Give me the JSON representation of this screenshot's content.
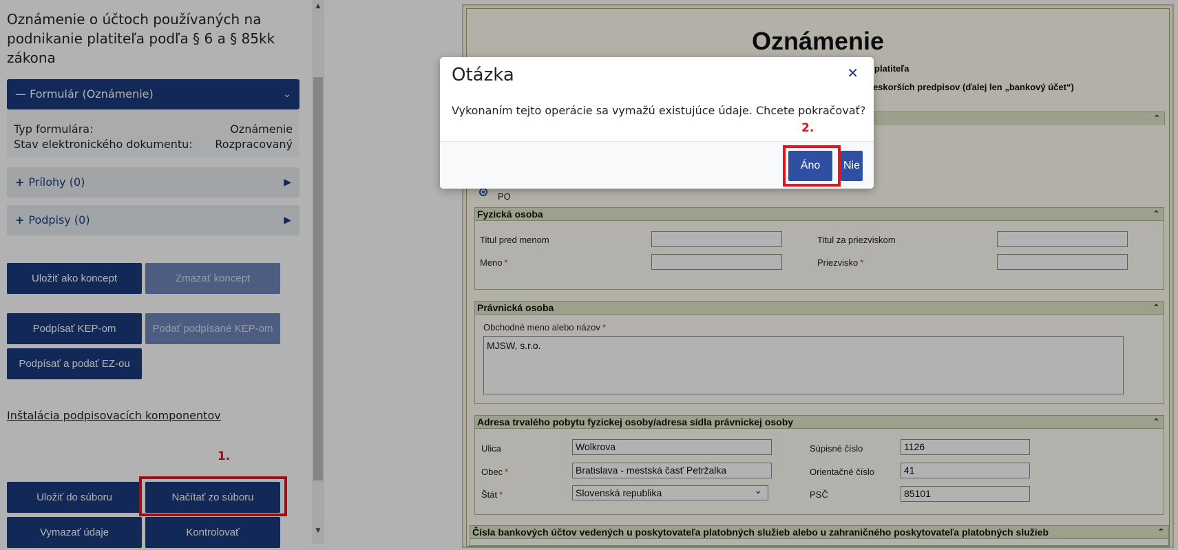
{
  "left": {
    "title": "Oznámenie o účtoch používaných na podnikanie platiteľa podľa § 6 a § 85kk zákona",
    "form_accordion": {
      "label": "Formulár (Oznámenie)",
      "type_label": "Typ formulára:",
      "type_value": "Oznámenie",
      "state_label": "Stav elektronického dokumentu:",
      "state_value": "Rozpracovaný"
    },
    "attachments_label": "Prílohy (0)",
    "signatures_label": "Podpisy (0)",
    "buttons": {
      "save_concept": "Uložiť ako koncept",
      "delete_concept": "Zmazať koncept",
      "sign_kep": "Podpísať KEP-om",
      "submit_signed_kep": "Podať podpísané KEP-om",
      "sign_submit_ez": "Podpísať a podať EZ-ou",
      "save_file": "Uložiť do súboru",
      "load_file": "Načítať zo súboru",
      "clear_data": "Vymazať údaje",
      "check": "Kontrolovať"
    },
    "install_link": "Inštalácia podpisovacích komponentov",
    "annotation_1": "1."
  },
  "form": {
    "title": "Oznámenie",
    "subtitle_1": "platiteľa",
    "subtitle_2": "neskorších predpisov (ďalej len „bankový účet“)",
    "radio_po": "PO",
    "physical": {
      "header": "Fyzická osoba",
      "title_before": "Titul pred menom",
      "title_after": "Titul za priezviskom",
      "first_name": "Meno",
      "surname": "Priezvisko",
      "req": "*"
    },
    "legal": {
      "header": "Právnická osoba",
      "name_label": "Obchodné meno alebo názov",
      "name_value": "MJSW, s.r.o."
    },
    "address": {
      "header": "Adresa trvalého pobytu fyzickej osoby/adresa sídla právnickej osoby",
      "street_label": "Ulica",
      "street_value": "Wolkrova",
      "supisne_label": "Súpisné číslo",
      "supisne_value": "1126",
      "city_label": "Obec",
      "city_value": "Bratislava - mestská časť Petržalka",
      "orient_label": "Orientačné číslo",
      "orient_value": "41",
      "state_label": "Štát",
      "state_value": "Slovenská republika",
      "psc_label": "PSČ",
      "psc_value": "85101"
    },
    "accounts_header": "Čísla bankových účtov vedených u poskytovateľa platobných služieb alebo u zahraničného poskytovateľa platobných služieb"
  },
  "modal": {
    "title": "Otázka",
    "message": "Vykonaním tejto operácie sa vymažú existujúce údaje. Chcete pokračovať?",
    "yes": "Áno",
    "no": "Nie",
    "annotation_2": "2."
  },
  "colors": {
    "primary": "#1b3b7e",
    "highlight": "#e0151f",
    "overlay": "rgba(0,0,0,0.30)"
  }
}
